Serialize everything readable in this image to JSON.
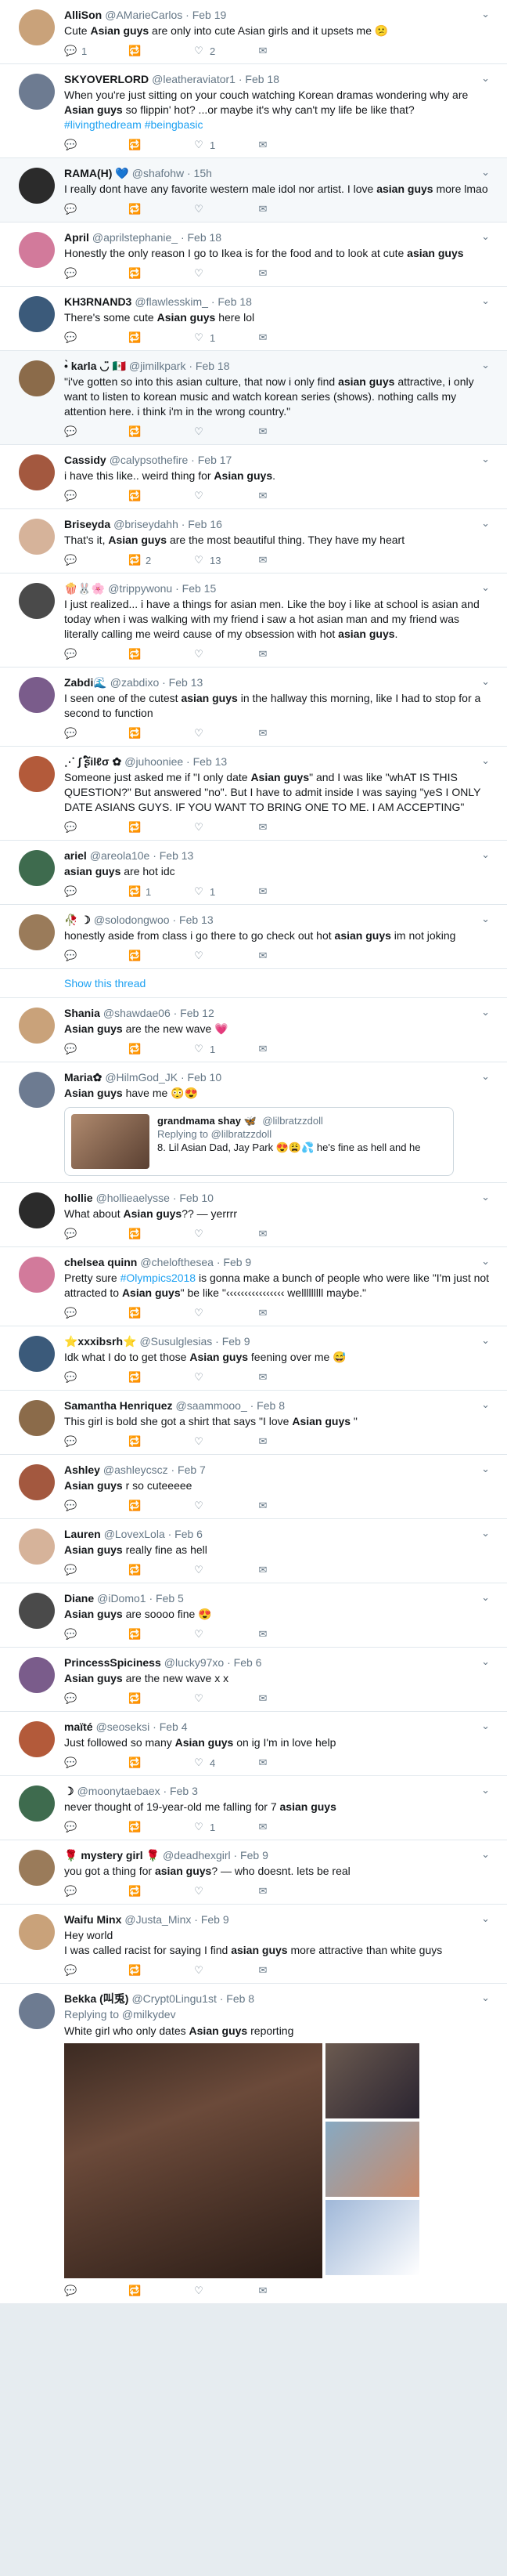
{
  "icons": {
    "reply": "💬",
    "retweet": "🔁",
    "like": "♡",
    "dm": "✉",
    "more": "⌄"
  },
  "colors": {
    "link": "#1da1f2",
    "muted": "#657786",
    "border": "#e1e8ed",
    "highlight": "#f5f8fa"
  },
  "tweets": [
    {
      "name": "AlliSon",
      "handle": "@AMarieCarlos · Feb 19",
      "text": "Cute Asian guys are only into cute Asian girls and it upsets me 😕",
      "replies": "1",
      "retweets": "",
      "likes": "2"
    },
    {
      "name": "SKYOVERLORD",
      "handle": "@leatheraviator1 · Feb 18",
      "text": "When you're just sitting on your couch watching Korean dramas wondering why are Asian guys so flippin' hot? ...or maybe it's why can't my life be like that? #livingthedream #beingbasic",
      "replies": "",
      "retweets": "",
      "likes": "1"
    },
    {
      "name": "RAMA(H) 💙",
      "handle": "@shafohw · 15h",
      "text": "I really dont have any favorite western male idol nor artist. I love asian guys more lmao",
      "replies": "",
      "retweets": "",
      "likes": ""
    },
    {
      "name": "April",
      "handle": "@aprilstephanie_ · Feb 18",
      "text": "Honestly the only reason I go to Ikea is for the food and to look at cute asian guys",
      "replies": "",
      "retweets": "",
      "likes": ""
    },
    {
      "name": "KH3RNAND3",
      "handle": "@flawlesskim_ · Feb 18",
      "text": "There's some cute Asian guys here lol",
      "replies": "",
      "retweets": "",
      "likes": "1"
    },
    {
      "name": "•̀ karla ◡̈ 🇲🇽",
      "handle": "@jimilkpark · Feb 18",
      "text": "\"i've gotten so into this asian culture, that now i only find asian guys attractive, i only want to listen to korean music and watch korean series (shows). nothing calls my attention here. i think i'm in the wrong country.\"",
      "replies": "",
      "retweets": "",
      "likes": ""
    },
    {
      "name": "Cassidy",
      "handle": "@calypsothefire · Feb 17",
      "text": "i have this like.. weird thing for Asian guys.",
      "replies": "",
      "retweets": "",
      "likes": ""
    },
    {
      "name": "Briseyda",
      "handle": "@briseydahh · Feb 16",
      "text": "That's it, Asian guys are the most beautiful thing. They have my heart",
      "replies": "",
      "retweets": "2",
      "likes": "13"
    },
    {
      "name": "🍿🐰🌸",
      "handle": "@trippywonu · Feb 15",
      "text": "I just realized... i have a things for asian men. Like the boy i like at school is asian and today when i was walking with my friend i saw a hot asian man and my friend was literally calling me weird cause of my obsession with hot asian guys.",
      "replies": "",
      "retweets": "",
      "likes": ""
    },
    {
      "name": "Zabdi🌊",
      "handle": "@zabdixo · Feb 13",
      "text": "I seen one of the cutest asian guys in the hallway this morning, like I had to stop for a second to function",
      "replies": "",
      "retweets": "",
      "likes": ""
    },
    {
      "name": "⋰ ∫ ʂ໌ilℓσ ✿",
      "handle": "@juhooniee · Feb 13",
      "text": "Someone just asked me if \"I only date Asian guys\" and I was like \"whAT IS THIS QUESTION?\" But answered \"no\". But I have to admit inside I was saying \"yeS I ONLY DATE ASIANS GUYS. IF YOU WANT TO BRING ONE TO ME. I AM ACCEPTING\"",
      "replies": "",
      "retweets": "",
      "likes": ""
    },
    {
      "name": "ariel",
      "handle": "@areola10e · Feb 13",
      "text": "asian guys are hot idc",
      "replies": "",
      "retweets": "1",
      "likes": "1"
    },
    {
      "name": "🥀 ☽",
      "handle": "@solodongwoo · Feb 13",
      "text": "honestly aside from class i go there to go check out hot asian guys im not joking",
      "replies": "",
      "retweets": "",
      "likes": ""
    }
  ],
  "show_thread": "Show this thread",
  "tweets2": [
    {
      "name": "Shania",
      "handle": "@shawdae06 · Feb 12",
      "text": "Asian guys are the new wave 💗",
      "replies": "",
      "retweets": "",
      "likes": "1"
    },
    {
      "name": "Maria✿",
      "handle": "@HilmGod_JK · Feb 10",
      "text": "Asian guys have me 😳😍",
      "card_name": "grandmama shay 🦋",
      "card_handle": "@lilbratzzdoll",
      "card_reply": "Replying to @lilbratzzdoll",
      "card_text": "8. Lil Asian Dad, Jay Park 😍😩💦 he's fine as hell and he"
    },
    {
      "name": "hollie",
      "handle": "@hollieaelysse · Feb 10",
      "text": "What about Asian guys?? — yerrrr",
      "replies": "",
      "retweets": "",
      "likes": ""
    },
    {
      "name": "chelsea quinn",
      "handle": "@chelofthesea · Feb 9",
      "text": "Pretty sure #Olympics2018 is gonna make a bunch of people who were like \"I'm just not attracted to Asian guys\" be like \"‹‹‹‹‹‹‹‹‹‹‹‹‹‹‹‹ welllllllll maybe.\"",
      "replies": "",
      "retweets": "",
      "likes": ""
    },
    {
      "name": "⭐xxxibsrh⭐",
      "handle": "@Susulglesias · Feb 9",
      "text": "Idk what I do to get those Asian guys feening over me 😅",
      "replies": "",
      "retweets": "",
      "likes": ""
    },
    {
      "name": "Samantha Henriquez",
      "handle": "@saammooo_ · Feb 8",
      "text": "This girl is bold she got a shirt that says \"I love Asian guys \"",
      "replies": "",
      "retweets": "",
      "likes": ""
    },
    {
      "name": "Ashley",
      "handle": "@ashleycscz · Feb 7",
      "text": "Asian guys r so cuteeeee",
      "replies": "",
      "retweets": "",
      "likes": ""
    },
    {
      "name": "Lauren",
      "handle": "@LovexLola · Feb 6",
      "text": "Asian guys really fine as hell",
      "replies": "",
      "retweets": "",
      "likes": ""
    },
    {
      "name": "Diane",
      "handle": "@iDomo1 · Feb 5",
      "text": "Asian guys are soooo fine 😍",
      "replies": "",
      "retweets": "",
      "likes": ""
    },
    {
      "name": "PrincessSpiciness",
      "handle": "@lucky97xo · Feb 6",
      "text": "Asian guys are the new wave x x",
      "replies": "",
      "retweets": "",
      "likes": ""
    },
    {
      "name": "maïté",
      "handle": "@seoseksi · Feb 4",
      "text": "Just followed so many Asian guys on ig I'm in love help",
      "replies": "",
      "retweets": "",
      "likes": "4"
    },
    {
      "name": "☽",
      "handle": "@moonytaebaex · Feb 3",
      "text": "never thought of 19-year-old me falling for 7 asian guys",
      "replies": "",
      "retweets": "",
      "likes": "1"
    },
    {
      "name": "🌹 mystery girl 🌹",
      "handle": "@deadhexgirl · Feb 9",
      "text": "you got a thing for asian guys? — who doesnt. lets be real",
      "replies": "",
      "retweets": "",
      "likes": ""
    },
    {
      "name": "Waifu Minx",
      "handle": "@Justa_Minx · Feb 9",
      "text": "Hey world\nI was called racist for saying I find asian guys more attractive than white guys",
      "replies": "",
      "retweets": "",
      "likes": ""
    },
    {
      "name": "Bekka (叫兎)",
      "handle": "@Crypt0Lingu1st · Feb 8",
      "reply_to": "Replying to @milkydev",
      "text": "White girl who only dates Asian guys reporting",
      "replies": "",
      "retweets": "",
      "likes": ""
    }
  ]
}
